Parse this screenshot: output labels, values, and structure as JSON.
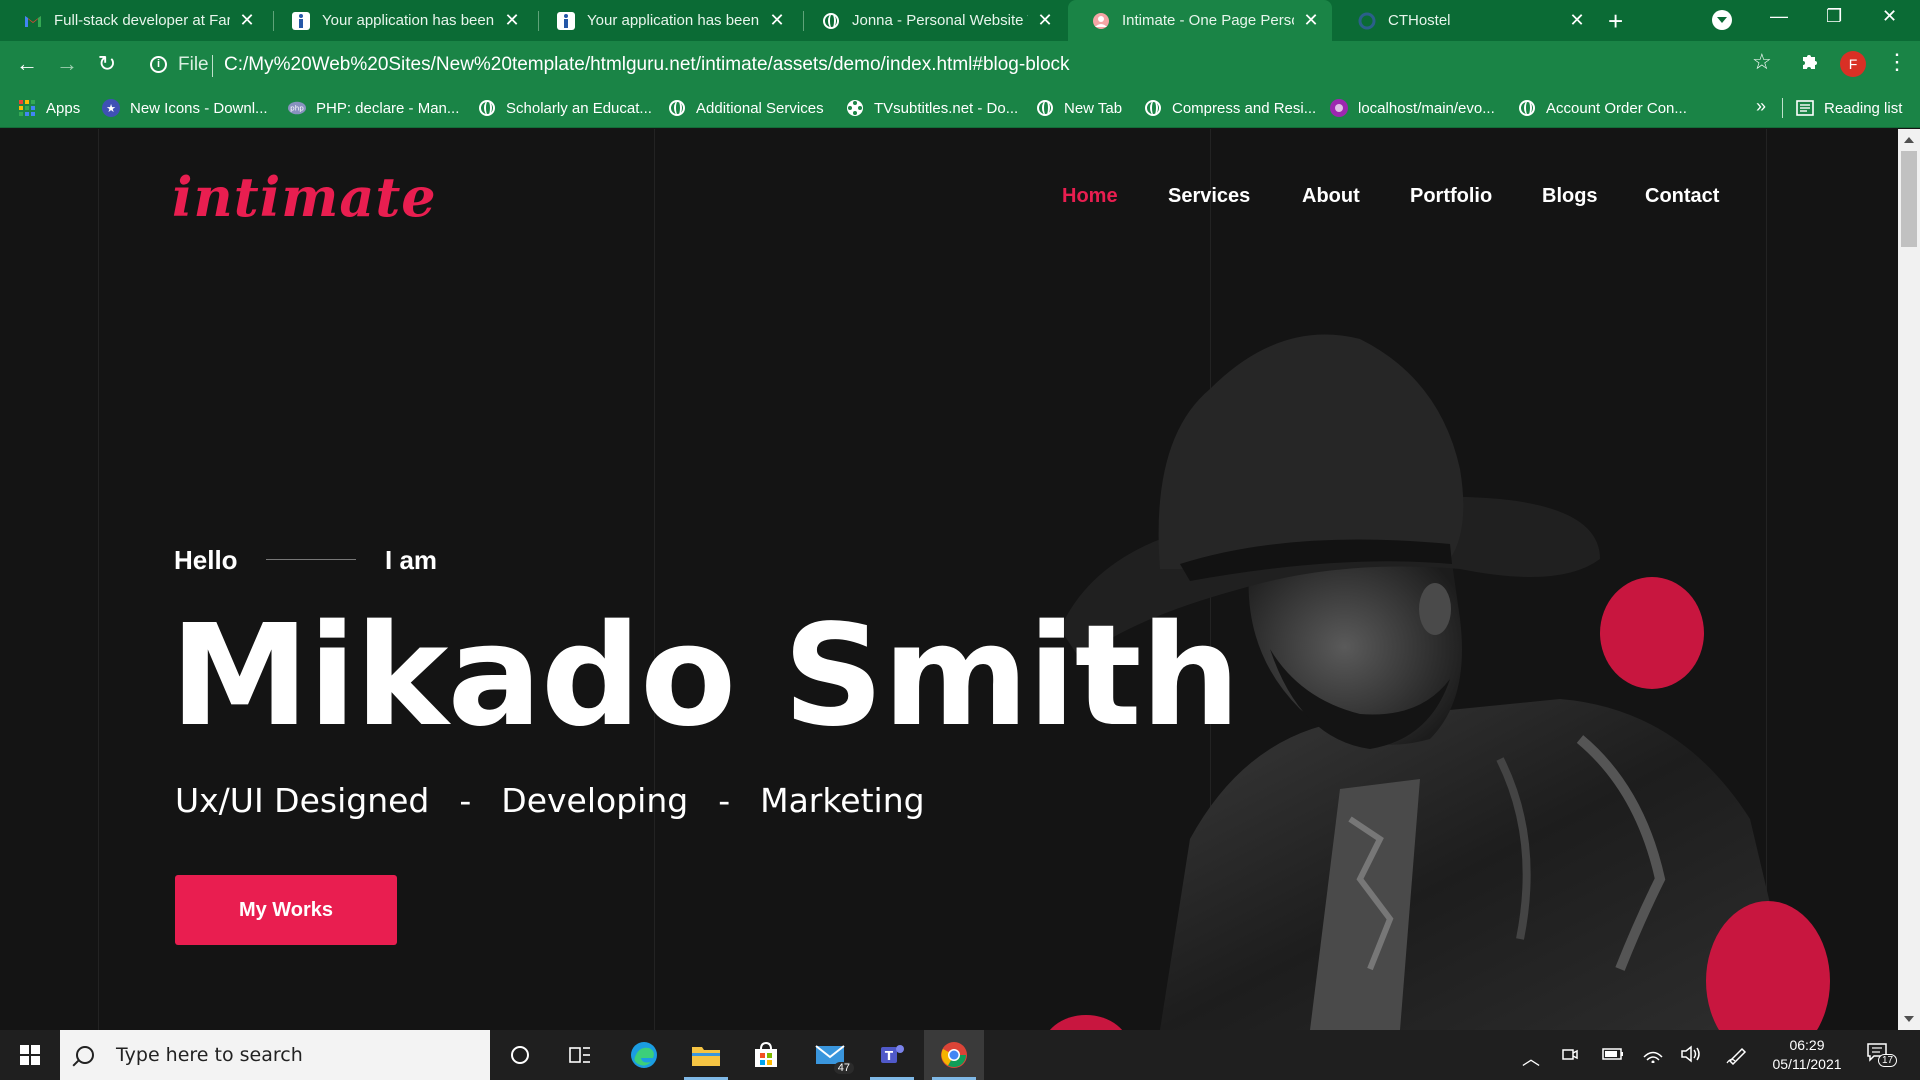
{
  "browser": {
    "tabs": [
      {
        "title": "Full-stack developer at Farm",
        "icon": "gmail-icon"
      },
      {
        "title": "Your application has been su",
        "icon": "indeed-icon"
      },
      {
        "title": "Your application has been su",
        "icon": "indeed-icon"
      },
      {
        "title": "Jonna - Personal Website Te",
        "icon": "globe-icon"
      },
      {
        "title": "Intimate - One Page Person",
        "icon": "site-icon",
        "active": true
      },
      {
        "title": "CTHostel",
        "icon": "loading-icon"
      }
    ],
    "address": {
      "scheme": "File",
      "url": "C:/My%20Web%20Sites/New%20template/htmlguru.net/intimate/assets/demo/index.html#blog-block"
    },
    "profile_initial": "F",
    "bookmarks": [
      {
        "label": "Apps",
        "icon": "apps-grid-icon"
      },
      {
        "label": "New Icons - Downl...",
        "icon": "star-badge-icon"
      },
      {
        "label": "PHP: declare - Man...",
        "icon": "php-icon"
      },
      {
        "label": "Scholarly an Educat...",
        "icon": "globe-icon"
      },
      {
        "label": "Additional Services",
        "icon": "globe-icon"
      },
      {
        "label": "TVsubtitles.net - Do...",
        "icon": "film-reel-icon"
      },
      {
        "label": "New Tab",
        "icon": "globe-icon"
      },
      {
        "label": "Compress and Resi...",
        "icon": "globe-icon"
      },
      {
        "label": "localhost/main/evo...",
        "icon": "purple-logo-icon"
      },
      {
        "label": "Account Order Con...",
        "icon": "globe-icon"
      }
    ],
    "more_bookmarks": "»",
    "reading_list": "Reading list"
  },
  "site": {
    "logo": "intimate",
    "nav": [
      "Home",
      "Services",
      "About",
      "Portfolio",
      "Blogs",
      "Contact"
    ],
    "active_nav": "Home",
    "hero": {
      "hello": "Hello",
      "iam": "I am",
      "name": "Mikado Smith",
      "roles": [
        "Ux/UI Designed",
        "Developing",
        "Marketing"
      ],
      "separator": "-",
      "cta": "My Works"
    },
    "colors": {
      "accent": "#e91e50",
      "background": "#141414",
      "dot": "#c8163f"
    }
  },
  "taskbar": {
    "search_placeholder": "Type here to search",
    "mail_badge": "47",
    "time": "06:29",
    "date": "05/11/2021",
    "notifications": "17"
  }
}
